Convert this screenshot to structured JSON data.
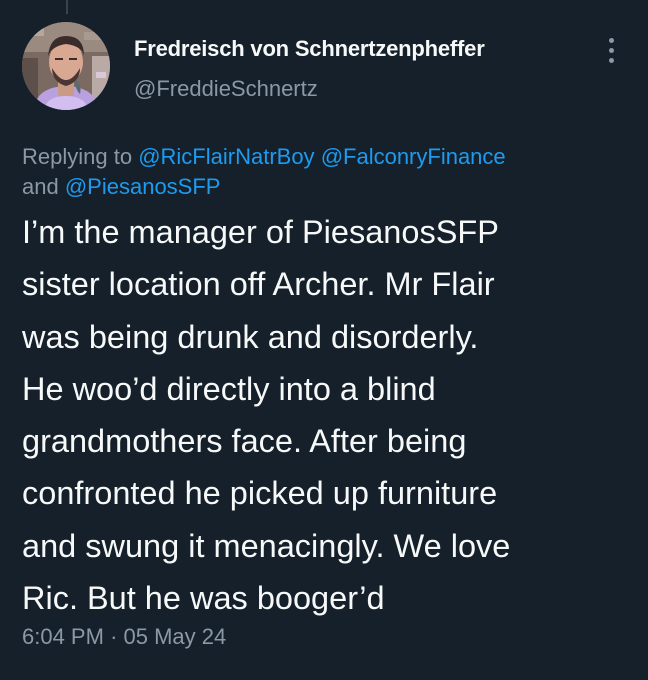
{
  "author": {
    "display_name": "Fredreisch von Schnertzenpheffer",
    "handle": "@FreddieSchnertz"
  },
  "reply_context": {
    "prefix": "Replying to",
    "mentions": [
      "@RicFlairNatrBoy",
      "@FalconryFinance",
      "@PiesanosSFP"
    ],
    "conjunction": "and"
  },
  "tweet": {
    "lines": [
      "I’m the manager of PiesanosSFP",
      "sister location off Archer. Mr Flair",
      "was being drunk and disorderly.",
      "He woo’d directly into a blind",
      "grandmothers face. After being",
      "confronted he picked up furniture",
      "and swung it menacingly. We love",
      "Ric. But he was booger’d"
    ],
    "time": "6:04 PM",
    "separator": "·",
    "date": "05 May 24"
  },
  "icons": {
    "more": "more-vertical-icon",
    "avatar": "profile-photo"
  },
  "colors": {
    "background": "#15202b",
    "primary_text": "#f7f9f9",
    "secondary_text": "#8b98a5",
    "link": "#1d9bf0",
    "thread_line": "#38444d"
  }
}
